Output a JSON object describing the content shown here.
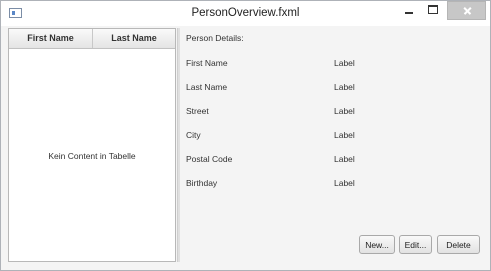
{
  "window": {
    "title": "PersonOverview.fxml"
  },
  "table": {
    "columns": [
      "First Name",
      "Last Name"
    ],
    "placeholder": "Kein Content in Tabelle"
  },
  "details": {
    "title": "Person Details:",
    "fields": [
      {
        "label": "First Name",
        "value": "Label"
      },
      {
        "label": "Last Name",
        "value": "Label"
      },
      {
        "label": "Street",
        "value": "Label"
      },
      {
        "label": "City",
        "value": "Label"
      },
      {
        "label": "Postal Code",
        "value": "Label"
      },
      {
        "label": "Birthday",
        "value": "Label"
      }
    ]
  },
  "buttons": {
    "new": "New...",
    "edit": "Edit...",
    "delete": "Delete"
  }
}
